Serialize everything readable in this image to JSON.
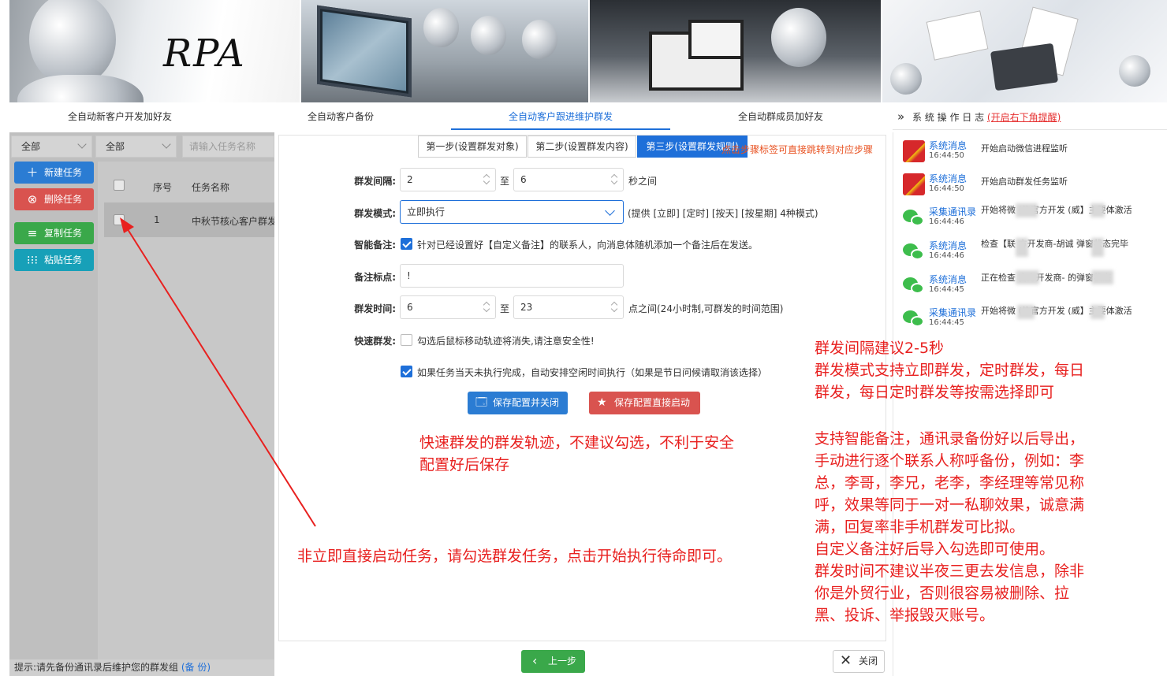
{
  "banner": {
    "logo_text": "RPA"
  },
  "top_tabs": [
    {
      "label": "全自动新客户开发加好友",
      "active": false
    },
    {
      "label": "全自动客户备份",
      "active": false
    },
    {
      "label": "全自动客户跟进维护群发",
      "active": true
    },
    {
      "label": "全自动群成员加好友",
      "active": false
    }
  ],
  "log_header": {
    "prefix": "»",
    "title": "系 统 操 作 日 志",
    "link": "(开启右下角提醒)"
  },
  "left": {
    "filter1": "全部",
    "filter2": "全部",
    "search_placeholder": "请输入任务名称",
    "buttons": {
      "new": "新建任务",
      "delete": "删除任务",
      "copy": "复制任务",
      "paste": "粘贴任务"
    },
    "table": {
      "col_index": "序号",
      "col_name": "任务名称",
      "rows": [
        {
          "index": "1",
          "name": "中秋节核心客户群发"
        }
      ]
    },
    "hint": "提示:请先备份通讯录后维护您的群发组",
    "hint_link": "(备 份)"
  },
  "steps": {
    "tabs": [
      {
        "label": "第一步(设置群发对象)",
        "active": false
      },
      {
        "label": "第二步(设置群发内容)",
        "active": false
      },
      {
        "label": "第三步(设置群发规则)",
        "active": true
      }
    ],
    "hint": "点击步骤标签可直接跳转到对应步骤"
  },
  "form": {
    "interval": {
      "label": "群发间隔:",
      "from": "2",
      "sep": "至",
      "to": "6",
      "unit": "秒之间"
    },
    "mode": {
      "label": "群发模式:",
      "value": "立即执行",
      "note": "(提供 [立即] [定时] [按天] [按星期] 4种模式)"
    },
    "smart_note": {
      "label": "智能备注:",
      "checked": true,
      "text": "针对已经设置好【自定义备注】的联系人，向消息体随机添加一个备注后在发送。"
    },
    "mark": {
      "label": "备注标点:",
      "value": "!"
    },
    "time": {
      "label": "群发时间:",
      "from": "6",
      "sep": "至",
      "to": "23",
      "unit": "点之间(24小时制,可群发的时间范围)"
    },
    "quick": {
      "label": "快速群发:",
      "checked": false,
      "text": "勾选后鼠标移动轨迹将消失,请注意安全性!"
    },
    "auto": {
      "checked": true,
      "text": "如果任务当天未执行完成，自动安排空闲时间执行（如果是节日问候请取消该选择）"
    },
    "save_close": "保存配置并关闭",
    "save_start": "保存配置直接启动"
  },
  "bottom": {
    "prev": "上一步",
    "close": "关闭"
  },
  "logs": [
    {
      "avatar": "flag",
      "title": "系统消息",
      "time": "16:44:50",
      "msg": "开始启动微信进程监听"
    },
    {
      "avatar": "flag",
      "title": "系统消息",
      "time": "16:44:50",
      "msg": "开始启动群发任务监听"
    },
    {
      "avatar": "wechat",
      "title": "采集通讯录",
      "time": "16:44:46",
      "msg": "开始将微 (信官方开发 (威】主要体激活"
    },
    {
      "avatar": "wechat",
      "title": "系统消息",
      "time": "16:44:46",
      "msg": "检查【联 方开发商-胡诚 弹窗状态完毕"
    },
    {
      "avatar": "wechat",
      "title": "系统消息",
      "time": "16:44:45",
      "msg": "正在检查 官方开发商- 的弹窗状态"
    },
    {
      "avatar": "wechat",
      "title": "采集通讯录",
      "time": "16:44:45",
      "msg": "开始将微 (信官方开发 (威】主要体激活"
    }
  ],
  "annotations": {
    "n1": [
      "群发间隔建议2-5秒",
      "群发模式支持立即群发，定时群发，每日",
      "群发，每日定时群发等按需选择即可"
    ],
    "n2": [
      "快速群发的群发轨迹，不建议勾选，不利于安全",
      "配置好后保存"
    ],
    "n3": [
      "支持智能备注，通讯录备份好以后导出，",
      "手动进行逐个联系人称呼备份，例如：李",
      "总，李哥，李兄，老李，李经理等常见称",
      "呼，效果等同于一对一私聊效果，诚意满",
      "满，回复率非手机群发可比拟。",
      "自定义备注好后导入勾选即可使用。",
      "群发时间不建议半夜三更去发信息，除非",
      "你是外贸行业，否则很容易被删除、拉",
      "黑、投诉、举报毁灭账号。"
    ],
    "n4": "非立即直接启动任务，请勾选群发任务，点击开始执行待命即可。"
  },
  "colors": {
    "accent": "#1e6fd9",
    "annotation": "#e8201f",
    "danger": "#d9534f",
    "success": "#3aa84a"
  }
}
